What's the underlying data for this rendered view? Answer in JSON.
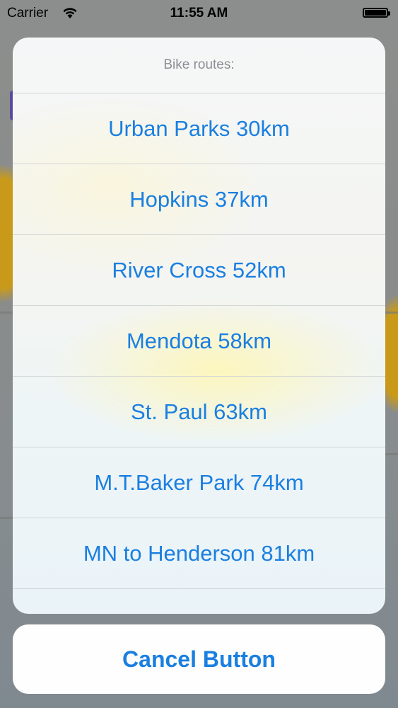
{
  "status_bar": {
    "carrier": "Carrier",
    "time": "11:55 AM"
  },
  "action_sheet": {
    "title": "Bike routes:",
    "options": [
      {
        "label": "Urban Parks 30km"
      },
      {
        "label": "Hopkins 37km"
      },
      {
        "label": "River Cross 52km"
      },
      {
        "label": "Mendota 58km"
      },
      {
        "label": "St. Paul 63km"
      },
      {
        "label": "M.T.Baker Park 74km"
      },
      {
        "label": "MN to Henderson 81km"
      }
    ],
    "cancel_label": "Cancel Button"
  },
  "colors": {
    "accent": "#1a7fe0",
    "title_gray": "#8e8e93"
  },
  "icons": [
    "wifi-icon",
    "battery-icon"
  ]
}
